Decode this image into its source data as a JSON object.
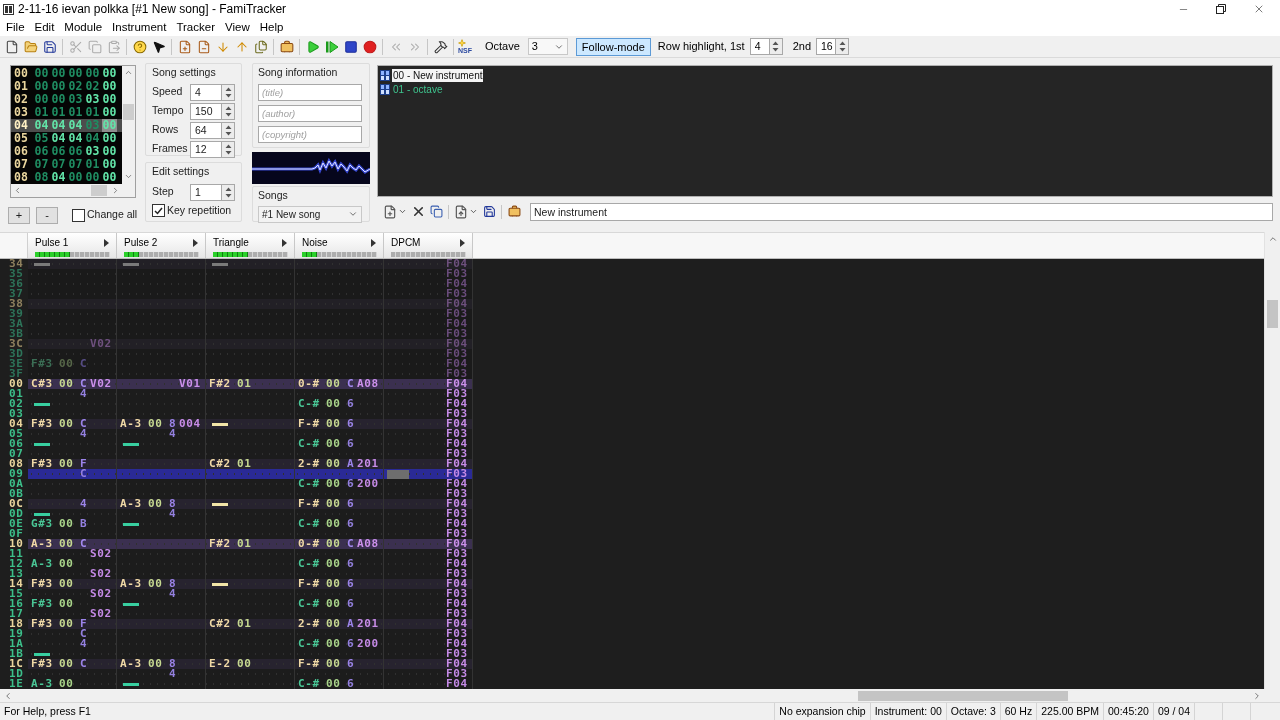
{
  "window": {
    "title": "2-11-16 ievan polkka [#1 New song] - FamiTracker"
  },
  "menu": [
    "File",
    "Edit",
    "Module",
    "Instrument",
    "Tracker",
    "View",
    "Help"
  ],
  "toolbar": {
    "groups": [
      [
        {
          "disabled": false
        },
        {
          "disabled": false
        },
        {
          "disabled": false
        }
      ],
      [
        {
          "disabled": true
        },
        {
          "disabled": true
        },
        {
          "disabled": true
        }
      ],
      [
        {
          "disabled": false
        },
        {
          "disabled": false
        }
      ],
      [
        {
          "disabled": false
        },
        {
          "disabled": false
        },
        {
          "disabled": false
        },
        {
          "disabled": false
        },
        {
          "disabled": false
        }
      ],
      [
        {
          "disabled": false
        }
      ],
      [
        {
          "disabled": false
        },
        {
          "disabled": false
        },
        {
          "disabled": false
        },
        {
          "disabled": false
        }
      ],
      [
        {
          "disabled": true
        },
        {
          "disabled": true
        }
      ],
      [
        {
          "disabled": false
        }
      ],
      [
        {
          "disabled": false,
          "label": "NSF"
        }
      ]
    ],
    "octave_label": "Octave",
    "octave": "3",
    "follow_mode": {
      "label": "Follow-mode",
      "on": true
    },
    "highlight_label": "Row highlight, 1st",
    "highlight_first": "4",
    "second_label": "2nd",
    "highlight_second": "16"
  },
  "frame_list": {
    "rows": [
      {
        "number": "00",
        "selected": false,
        "cells": [
          {
            "text": "00",
            "bright": false
          },
          {
            "text": "00",
            "bright": false
          },
          {
            "text": "00",
            "bright": false
          },
          {
            "text": "00",
            "bright": false
          },
          {
            "text": "00",
            "bright": true
          }
        ]
      },
      {
        "number": "01",
        "selected": false,
        "cells": [
          {
            "text": "00",
            "bright": false
          },
          {
            "text": "00",
            "bright": false
          },
          {
            "text": "02",
            "bright": false
          },
          {
            "text": "02",
            "bright": false
          },
          {
            "text": "00",
            "bright": true
          }
        ]
      },
      {
        "number": "02",
        "selected": false,
        "cells": [
          {
            "text": "00",
            "bright": false
          },
          {
            "text": "00",
            "bright": false
          },
          {
            "text": "03",
            "bright": false
          },
          {
            "text": "03",
            "bright": true
          },
          {
            "text": "00",
            "bright": true
          }
        ]
      },
      {
        "number": "03",
        "selected": false,
        "cells": [
          {
            "text": "01",
            "bright": false
          },
          {
            "text": "01",
            "bright": false
          },
          {
            "text": "01",
            "bright": false
          },
          {
            "text": "01",
            "bright": false
          },
          {
            "text": "00",
            "bright": true
          }
        ]
      },
      {
        "number": "04",
        "selected": true,
        "cells": [
          {
            "text": "04",
            "bright": true
          },
          {
            "text": "04",
            "bright": true
          },
          {
            "text": "04",
            "bright": true
          },
          {
            "text": "03",
            "bright": false
          },
          {
            "text": "00",
            "bright": true,
            "cursor": true
          }
        ]
      },
      {
        "number": "05",
        "selected": false,
        "cells": [
          {
            "text": "05",
            "bright": false
          },
          {
            "text": "04",
            "bright": true
          },
          {
            "text": "04",
            "bright": true
          },
          {
            "text": "04",
            "bright": false
          },
          {
            "text": "00",
            "bright": true
          }
        ]
      },
      {
        "number": "06",
        "selected": false,
        "cells": [
          {
            "text": "06",
            "bright": false
          },
          {
            "text": "06",
            "bright": false
          },
          {
            "text": "06",
            "bright": false
          },
          {
            "text": "03",
            "bright": true
          },
          {
            "text": "00",
            "bright": true
          }
        ]
      },
      {
        "number": "07",
        "selected": false,
        "cells": [
          {
            "text": "07",
            "bright": false
          },
          {
            "text": "07",
            "bright": false
          },
          {
            "text": "07",
            "bright": false
          },
          {
            "text": "01",
            "bright": false
          },
          {
            "text": "00",
            "bright": true
          }
        ]
      },
      {
        "number": "08",
        "selected": false,
        "cells": [
          {
            "text": "08",
            "bright": false
          },
          {
            "text": "04",
            "bright": true
          },
          {
            "text": "00",
            "bright": false
          },
          {
            "text": "00",
            "bright": false
          },
          {
            "text": "00",
            "bright": true
          }
        ]
      }
    ]
  },
  "frame_buttons": [
    "+",
    "-"
  ],
  "change_all": {
    "label": "Change all",
    "checked": false
  },
  "song_settings": {
    "title": "Song settings",
    "fields": [
      {
        "label": "Speed",
        "value": "4"
      },
      {
        "label": "Tempo",
        "value": "150"
      },
      {
        "label": "Rows",
        "value": "64"
      },
      {
        "label": "Frames",
        "value": "12"
      }
    ]
  },
  "edit_settings": {
    "title": "Edit settings",
    "step": {
      "label": "Step",
      "value": "1"
    },
    "key_repetition": {
      "label": "Key repetition",
      "checked": true
    }
  },
  "song_information": {
    "title": "Song information",
    "fields": [
      {
        "placeholder": "(title)"
      },
      {
        "placeholder": "(author)"
      },
      {
        "placeholder": "(copyright)"
      }
    ]
  },
  "songs": {
    "label": "Songs",
    "value": "#1 New song"
  },
  "instruments": {
    "items": [
      {
        "label": "00 - New instrument",
        "selected": true
      },
      {
        "label": "01 - octave",
        "selected": false
      }
    ],
    "name": "New instrument"
  },
  "pattern": {
    "channels": [
      {
        "name": "Pulse 1",
        "level": 0.47
      },
      {
        "name": "Pulse 2",
        "level": 0.2
      },
      {
        "name": "Triangle",
        "level": 0.47
      },
      {
        "name": "Noise",
        "level": 0.2
      },
      {
        "name": "DPCM"
      }
    ],
    "previous_rows": [
      {
        "number": "34",
        "kind": "beat",
        "selected": false,
        "cells": [
          {
            "kind": "cut"
          },
          {
            "kind": "cut"
          },
          {
            "kind": "cut"
          },
          null,
          {
            "kind": "entry",
            "fx": "F04"
          }
        ]
      },
      {
        "number": "35",
        "kind": "normal",
        "selected": false,
        "cells": [
          null,
          null,
          null,
          null,
          {
            "kind": "entry",
            "fx": "F03"
          }
        ]
      },
      {
        "number": "36",
        "kind": "normal",
        "selected": false,
        "cells": [
          null,
          null,
          null,
          null,
          {
            "kind": "entry",
            "fx": "F04"
          }
        ]
      },
      {
        "number": "37",
        "kind": "normal",
        "selected": false,
        "cells": [
          null,
          null,
          null,
          null,
          {
            "kind": "entry",
            "fx": "F03"
          }
        ]
      },
      {
        "number": "38",
        "kind": "beat",
        "selected": false,
        "cells": [
          null,
          null,
          null,
          null,
          {
            "kind": "entry",
            "fx": "F04"
          }
        ]
      },
      {
        "number": "39",
        "kind": "normal",
        "selected": false,
        "cells": [
          null,
          null,
          null,
          null,
          {
            "kind": "entry",
            "fx": "F03"
          }
        ]
      },
      {
        "number": "3A",
        "kind": "normal",
        "selected": false,
        "cells": [
          null,
          null,
          null,
          null,
          {
            "kind": "entry",
            "fx": "F04"
          }
        ]
      },
      {
        "number": "3B",
        "kind": "normal",
        "selected": false,
        "cells": [
          null,
          null,
          null,
          null,
          {
            "kind": "entry",
            "fx": "F03"
          }
        ]
      },
      {
        "number": "3C",
        "kind": "beat",
        "selected": false,
        "cells": [
          {
            "kind": "entry",
            "fx": "V02"
          },
          null,
          null,
          null,
          {
            "kind": "entry",
            "fx": "F04"
          }
        ]
      },
      {
        "number": "3D",
        "kind": "normal",
        "selected": false,
        "cells": [
          null,
          null,
          null,
          null,
          {
            "kind": "entry",
            "fx": "F03"
          }
        ]
      },
      {
        "number": "3E",
        "kind": "normal",
        "selected": false,
        "cells": [
          {
            "kind": "entry",
            "note": "F#3",
            "inst": "00",
            "vol": "C"
          },
          null,
          null,
          null,
          {
            "kind": "entry",
            "fx": "F04"
          }
        ]
      },
      {
        "number": "3F",
        "kind": "normal",
        "selected": false,
        "cells": [
          null,
          null,
          null,
          null,
          {
            "kind": "entry",
            "fx": "F03"
          }
        ]
      }
    ],
    "rows": [
      {
        "number": "00",
        "kind": "measure",
        "selected": false,
        "cells": [
          {
            "kind": "entry",
            "note": "C#3",
            "inst": "00",
            "vol": "C",
            "fx": "V02"
          },
          {
            "kind": "entry",
            "fx": "V01"
          },
          {
            "kind": "entry",
            "note": "F#2",
            "inst": "01"
          },
          {
            "kind": "entry",
            "note": "0-#",
            "inst": "00",
            "vol": "C",
            "fx": "A08"
          },
          {
            "kind": "entry",
            "fx": "F04"
          }
        ]
      },
      {
        "number": "01",
        "kind": "normal",
        "selected": false,
        "cells": [
          {
            "kind": "entry",
            "vol": "4"
          },
          null,
          null,
          null,
          {
            "kind": "entry",
            "fx": "F03"
          }
        ]
      },
      {
        "number": "02",
        "kind": "normal",
        "selected": false,
        "cells": [
          {
            "kind": "cut"
          },
          null,
          null,
          {
            "kind": "entry",
            "note": "C-#",
            "inst": "00",
            "vol": "6"
          },
          {
            "kind": "entry",
            "fx": "F04"
          }
        ]
      },
      {
        "number": "03",
        "kind": "normal",
        "selected": false,
        "cells": [
          null,
          null,
          null,
          null,
          {
            "kind": "entry",
            "fx": "F03"
          }
        ]
      },
      {
        "number": "04",
        "kind": "beat",
        "selected": false,
        "cells": [
          {
            "kind": "entry",
            "note": "F#3",
            "inst": "00",
            "vol": "C"
          },
          {
            "kind": "entry",
            "note": "A-3",
            "inst": "00",
            "vol": "8",
            "fx": "004"
          },
          {
            "kind": "cut"
          },
          {
            "kind": "entry",
            "note": "F-#",
            "inst": "00",
            "vol": "6"
          },
          {
            "kind": "entry",
            "fx": "F04"
          }
        ]
      },
      {
        "number": "05",
        "kind": "normal",
        "selected": false,
        "cells": [
          {
            "kind": "entry",
            "vol": "4"
          },
          {
            "kind": "entry",
            "vol": "4"
          },
          null,
          null,
          {
            "kind": "entry",
            "fx": "F03"
          }
        ]
      },
      {
        "number": "06",
        "kind": "normal",
        "selected": false,
        "cells": [
          {
            "kind": "cut"
          },
          {
            "kind": "cut"
          },
          null,
          {
            "kind": "entry",
            "note": "C-#",
            "inst": "00",
            "vol": "6"
          },
          {
            "kind": "entry",
            "fx": "F04"
          }
        ]
      },
      {
        "number": "07",
        "kind": "normal",
        "selected": false,
        "cells": [
          null,
          null,
          null,
          null,
          {
            "kind": "entry",
            "fx": "F03"
          }
        ]
      },
      {
        "number": "08",
        "kind": "beat",
        "selected": false,
        "cells": [
          {
            "kind": "entry",
            "note": "F#3",
            "inst": "00",
            "vol": "F"
          },
          null,
          {
            "kind": "entry",
            "note": "C#2",
            "inst": "01"
          },
          {
            "kind": "entry",
            "note": "2-#",
            "inst": "00",
            "vol": "A",
            "fx": "201"
          },
          {
            "kind": "entry",
            "fx": "F04"
          }
        ]
      },
      {
        "number": "09",
        "kind": "normal",
        "selected": true,
        "cells": [
          {
            "kind": "entry",
            "vol": "C"
          },
          null,
          null,
          null,
          {
            "kind": "entry",
            "fx": "F03",
            "cursor": true
          }
        ]
      },
      {
        "number": "0A",
        "kind": "normal",
        "selected": false,
        "cells": [
          null,
          null,
          null,
          {
            "kind": "entry",
            "note": "C-#",
            "inst": "00",
            "vol": "6",
            "fx": "200"
          },
          {
            "kind": "entry",
            "fx": "F04"
          }
        ]
      },
      {
        "number": "0B",
        "kind": "normal",
        "selected": false,
        "cells": [
          null,
          null,
          null,
          null,
          {
            "kind": "entry",
            "fx": "F03"
          }
        ]
      },
      {
        "number": "0C",
        "kind": "beat",
        "selected": false,
        "cells": [
          {
            "kind": "entry",
            "vol": "4"
          },
          {
            "kind": "entry",
            "note": "A-3",
            "inst": "00",
            "vol": "8"
          },
          {
            "kind": "cut"
          },
          {
            "kind": "entry",
            "note": "F-#",
            "inst": "00",
            "vol": "6"
          },
          {
            "kind": "entry",
            "fx": "F04"
          }
        ]
      },
      {
        "number": "0D",
        "kind": "normal",
        "selected": false,
        "cells": [
          {
            "kind": "cut"
          },
          {
            "kind": "entry",
            "vol": "4"
          },
          null,
          null,
          {
            "kind": "entry",
            "fx": "F03"
          }
        ]
      },
      {
        "number": "0E",
        "kind": "normal",
        "selected": false,
        "cells": [
          {
            "kind": "entry",
            "note": "G#3",
            "inst": "00",
            "vol": "B"
          },
          {
            "kind": "cut"
          },
          null,
          {
            "kind": "entry",
            "note": "C-#",
            "inst": "00",
            "vol": "6"
          },
          {
            "kind": "entry",
            "fx": "F04"
          }
        ]
      },
      {
        "number": "0F",
        "kind": "normal",
        "selected": false,
        "cells": [
          null,
          null,
          null,
          null,
          {
            "kind": "entry",
            "fx": "F03"
          }
        ]
      },
      {
        "number": "10",
        "kind": "measure",
        "selected": false,
        "cells": [
          {
            "kind": "entry",
            "note": "A-3",
            "inst": "00",
            "vol": "C"
          },
          null,
          {
            "kind": "entry",
            "note": "F#2",
            "inst": "01"
          },
          {
            "kind": "entry",
            "note": "0-#",
            "inst": "00",
            "vol": "C",
            "fx": "A08"
          },
          {
            "kind": "entry",
            "fx": "F04"
          }
        ]
      },
      {
        "number": "11",
        "kind": "normal",
        "selected": false,
        "cells": [
          {
            "kind": "entry",
            "fx": "S02"
          },
          null,
          null,
          null,
          {
            "kind": "entry",
            "fx": "F03"
          }
        ]
      },
      {
        "number": "12",
        "kind": "normal",
        "selected": false,
        "cells": [
          {
            "kind": "entry",
            "note": "A-3",
            "inst": "00"
          },
          null,
          null,
          {
            "kind": "entry",
            "note": "C-#",
            "inst": "00",
            "vol": "6"
          },
          {
            "kind": "entry",
            "fx": "F04"
          }
        ]
      },
      {
        "number": "13",
        "kind": "normal",
        "selected": false,
        "cells": [
          {
            "kind": "entry",
            "fx": "S02"
          },
          null,
          null,
          null,
          {
            "kind": "entry",
            "fx": "F03"
          }
        ]
      },
      {
        "number": "14",
        "kind": "beat",
        "selected": false,
        "cells": [
          {
            "kind": "entry",
            "note": "F#3",
            "inst": "00"
          },
          {
            "kind": "entry",
            "note": "A-3",
            "inst": "00",
            "vol": "8"
          },
          {
            "kind": "cut"
          },
          {
            "kind": "entry",
            "note": "F-#",
            "inst": "00",
            "vol": "6"
          },
          {
            "kind": "entry",
            "fx": "F04"
          }
        ]
      },
      {
        "number": "15",
        "kind": "normal",
        "selected": false,
        "cells": [
          {
            "kind": "entry",
            "fx": "S02"
          },
          {
            "kind": "entry",
            "vol": "4"
          },
          null,
          null,
          {
            "kind": "entry",
            "fx": "F03"
          }
        ]
      },
      {
        "number": "16",
        "kind": "normal",
        "selected": false,
        "cells": [
          {
            "kind": "entry",
            "note": "F#3",
            "inst": "00"
          },
          {
            "kind": "cut"
          },
          null,
          {
            "kind": "entry",
            "note": "C-#",
            "inst": "00",
            "vol": "6"
          },
          {
            "kind": "entry",
            "fx": "F04"
          }
        ]
      },
      {
        "number": "17",
        "kind": "normal",
        "selected": false,
        "cells": [
          {
            "kind": "entry",
            "fx": "S02"
          },
          null,
          null,
          null,
          {
            "kind": "entry",
            "fx": "F03"
          }
        ]
      },
      {
        "number": "18",
        "kind": "beat",
        "selected": false,
        "cells": [
          {
            "kind": "entry",
            "note": "F#3",
            "inst": "00",
            "vol": "F"
          },
          null,
          {
            "kind": "entry",
            "note": "C#2",
            "inst": "01"
          },
          {
            "kind": "entry",
            "note": "2-#",
            "inst": "00",
            "vol": "A",
            "fx": "201"
          },
          {
            "kind": "entry",
            "fx": "F04"
          }
        ]
      },
      {
        "number": "19",
        "kind": "normal",
        "selected": false,
        "cells": [
          {
            "kind": "entry",
            "vol": "C"
          },
          null,
          null,
          null,
          {
            "kind": "entry",
            "fx": "F03"
          }
        ]
      },
      {
        "number": "1A",
        "kind": "normal",
        "selected": false,
        "cells": [
          {
            "kind": "entry",
            "vol": "4"
          },
          null,
          null,
          {
            "kind": "entry",
            "note": "C-#",
            "inst": "00",
            "vol": "6",
            "fx": "200"
          },
          {
            "kind": "entry",
            "fx": "F04"
          }
        ]
      },
      {
        "number": "1B",
        "kind": "normal",
        "selected": false,
        "cells": [
          {
            "kind": "cut"
          },
          null,
          null,
          null,
          {
            "kind": "entry",
            "fx": "F03"
          }
        ]
      },
      {
        "number": "1C",
        "kind": "beat",
        "selected": false,
        "cells": [
          {
            "kind": "entry",
            "note": "F#3",
            "inst": "00",
            "vol": "C"
          },
          {
            "kind": "entry",
            "note": "A-3",
            "inst": "00",
            "vol": "8"
          },
          {
            "kind": "entry",
            "note": "E-2",
            "inst": "00"
          },
          {
            "kind": "entry",
            "note": "F-#",
            "inst": "00",
            "vol": "6"
          },
          {
            "kind": "entry",
            "fx": "F04"
          }
        ]
      },
      {
        "number": "1D",
        "kind": "normal",
        "selected": false,
        "cells": [
          null,
          {
            "kind": "entry",
            "vol": "4"
          },
          null,
          null,
          {
            "kind": "entry",
            "fx": "F03"
          }
        ]
      },
      {
        "number": "1E",
        "kind": "normal",
        "selected": false,
        "cells": [
          {
            "kind": "entry",
            "note": "A-3",
            "inst": "00"
          },
          {
            "kind": "cut"
          },
          null,
          {
            "kind": "entry",
            "note": "C-#",
            "inst": "00",
            "vol": "6"
          },
          {
            "kind": "entry",
            "fx": "F04"
          }
        ]
      }
    ]
  },
  "status_bar": {
    "help": "For Help, press F1",
    "panes": [
      "No expansion chip",
      "Instrument: 00",
      "Octave: 3",
      "60 Hz",
      "225.00 BPM",
      "00:45:20",
      "09 / 04"
    ]
  }
}
